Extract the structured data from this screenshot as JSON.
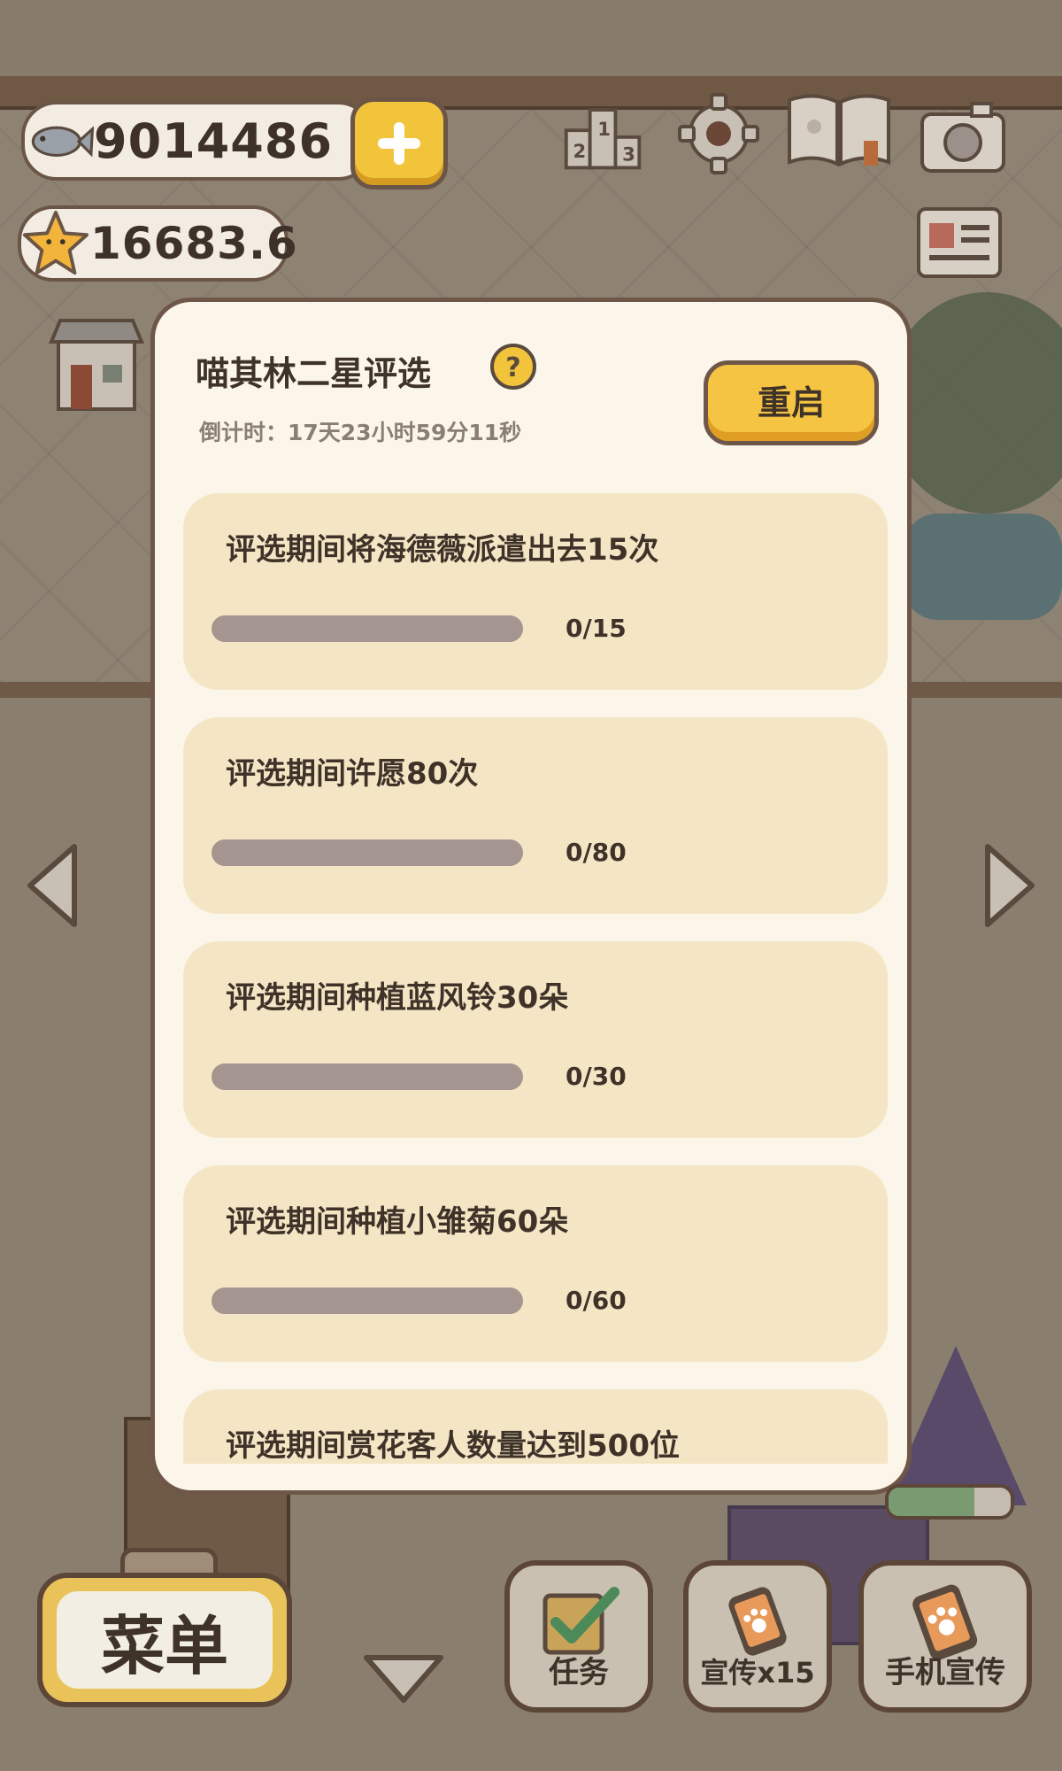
{
  "hud": {
    "fish_value": "9014486",
    "star_value": "16683.6"
  },
  "modal": {
    "title": "喵其林二星评选",
    "countdown": "倒计时：17天23小时59分11秒",
    "restart_label": "重启",
    "tasks": [
      {
        "text": "评选期间将海德薇派遣出去15次",
        "progress": "0/15",
        "fraction": 0
      },
      {
        "text": "评选期间许愿80次",
        "progress": "0/80",
        "fraction": 0
      },
      {
        "text": "评选期间种植蓝风铃30朵",
        "progress": "0/30",
        "fraction": 0
      },
      {
        "text": "评选期间种植小雏菊60朵",
        "progress": "0/60",
        "fraction": 0
      },
      {
        "text": "评选期间赏花客人数量达到500位",
        "progress": "",
        "fraction": 0
      }
    ]
  },
  "bottom": {
    "menu_label": "菜单",
    "task_label": "任务",
    "promo_label": "宣传x15",
    "phone_promo_label": "手机宣传",
    "stamina_fraction": 0.7
  },
  "colors": {
    "accent_yellow": "#f6c443",
    "card_bg": "#f4e6c5",
    "track": "#a59591",
    "text_dark": "#3e3229"
  }
}
